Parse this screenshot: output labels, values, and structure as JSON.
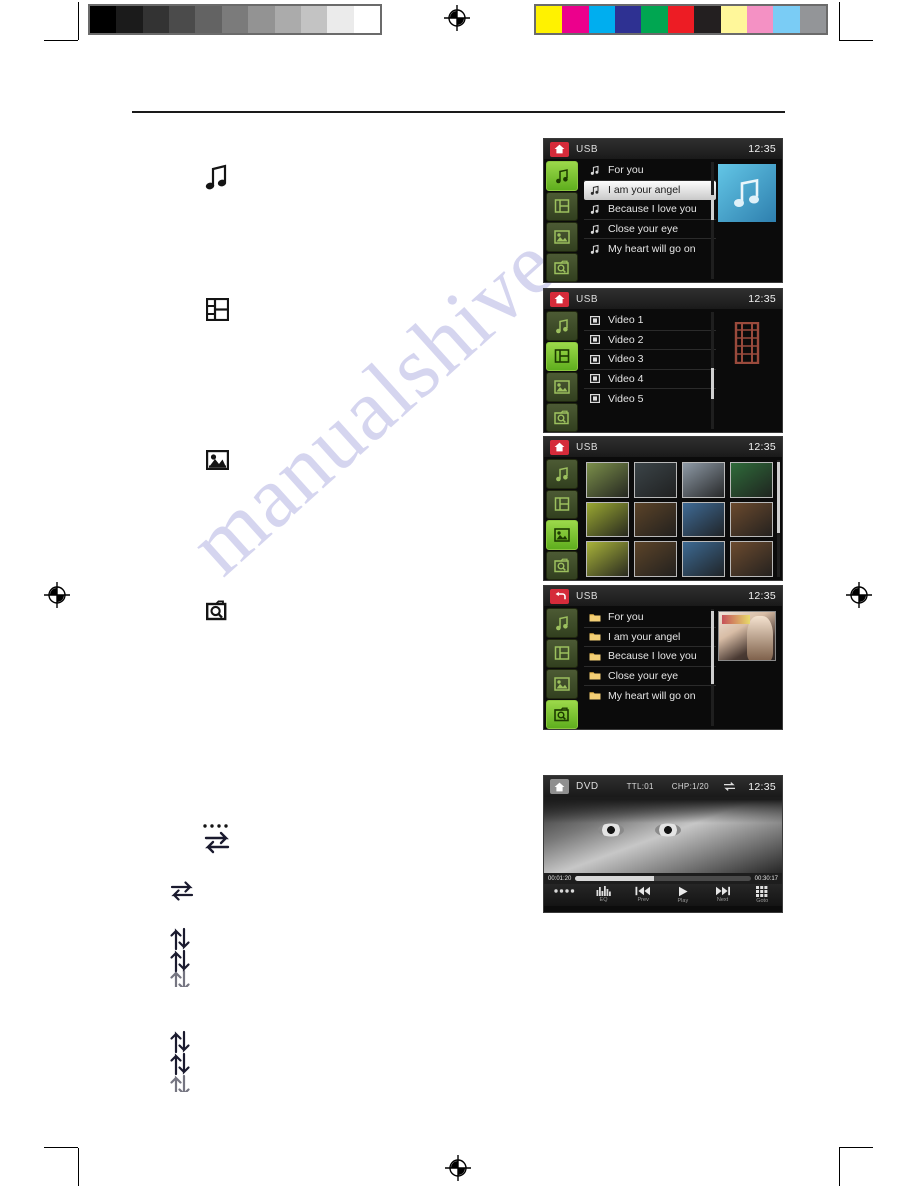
{
  "page": {
    "watermark": "manualshive",
    "calibration": {
      "gray_swatches": [
        "#000000",
        "#1b1b1b",
        "#333333",
        "#4b4b4b",
        "#636363",
        "#7b7b7b",
        "#939393",
        "#ababab",
        "#c3c3c3",
        "#ebebeb",
        "#ffffff"
      ],
      "color_swatches": [
        "#fff200",
        "#ec008c",
        "#00aeef",
        "#2e3192",
        "#00a651",
        "#ed1c24",
        "#231f20",
        "#fff79a",
        "#f491c4",
        "#7accf5",
        "#939598"
      ]
    }
  },
  "legend_icons": [
    {
      "name": "music-note-icon",
      "label": "Music"
    },
    {
      "name": "film-strip-icon",
      "label": "Video"
    },
    {
      "name": "picture-icon",
      "label": "Photo"
    },
    {
      "name": "folder-search-icon",
      "label": "Browse"
    },
    {
      "name": "repeat-dots-icon",
      "label": "Repeat"
    },
    {
      "name": "repeat-one-icon",
      "label": "Repeat one"
    },
    {
      "name": "repeat-all-icon",
      "label": "Repeat all"
    },
    {
      "name": "repeat-folder-icon",
      "label": "Repeat folder"
    }
  ],
  "screens": [
    {
      "id": "usb-music",
      "source": "USB",
      "clock": "12:35",
      "home_icon": "home-icon",
      "rail": [
        {
          "icon": "music-note-icon",
          "active": true
        },
        {
          "icon": "film-strip-icon",
          "active": false
        },
        {
          "icon": "picture-icon",
          "active": false
        },
        {
          "icon": "folder-search-icon",
          "active": false
        }
      ],
      "rows": [
        {
          "icon": "music-note-icon",
          "label": "For you",
          "selected": false
        },
        {
          "icon": "music-note-icon",
          "label": "I am your angel",
          "selected": true
        },
        {
          "icon": "music-note-icon",
          "label": "Because I love you",
          "selected": false
        },
        {
          "icon": "music-note-icon",
          "label": "Close your eye",
          "selected": false
        },
        {
          "icon": "music-note-icon",
          "label": "My heart will go on",
          "selected": false
        }
      ],
      "art": "album-art-music-note"
    },
    {
      "id": "usb-video",
      "source": "USB",
      "clock": "12:35",
      "home_icon": "home-icon",
      "rail": [
        {
          "icon": "music-note-icon",
          "active": false
        },
        {
          "icon": "film-strip-icon",
          "active": true
        },
        {
          "icon": "picture-icon",
          "active": false
        },
        {
          "icon": "folder-search-icon",
          "active": false
        }
      ],
      "rows": [
        {
          "icon": "video-clip-icon",
          "label": "Video 1",
          "selected": false
        },
        {
          "icon": "video-clip-icon",
          "label": "Video 2",
          "selected": false
        },
        {
          "icon": "video-clip-icon",
          "label": "Video 3",
          "selected": false
        },
        {
          "icon": "video-clip-icon",
          "label": "Video 4",
          "selected": false
        },
        {
          "icon": "video-clip-icon",
          "label": "Video 5",
          "selected": false
        }
      ],
      "art": "film-strip-art"
    },
    {
      "id": "usb-photo",
      "source": "USB",
      "clock": "12:35",
      "home_icon": "home-icon",
      "rail": [
        {
          "icon": "music-note-icon",
          "active": false
        },
        {
          "icon": "film-strip-icon",
          "active": false
        },
        {
          "icon": "picture-icon",
          "active": true
        },
        {
          "icon": "folder-search-icon",
          "active": false
        }
      ],
      "thumbnails": [
        "#7b8f4a",
        "#3b4448",
        "#8e9aa6",
        "#2f6b3a",
        "#9aa832",
        "#5b4328",
        "#3f6b96",
        "#6b4a2e",
        "#a8b33a",
        "#5c4429",
        "#3d6a93",
        "#6c4b2f"
      ]
    },
    {
      "id": "usb-browse",
      "source": "USB",
      "clock": "12:35",
      "home_icon": "back-icon",
      "rail": [
        {
          "icon": "music-note-icon",
          "active": false
        },
        {
          "icon": "film-strip-icon",
          "active": false
        },
        {
          "icon": "picture-icon",
          "active": false
        },
        {
          "icon": "folder-search-icon",
          "active": true
        }
      ],
      "rows": [
        {
          "icon": "folder-icon",
          "label": "For you",
          "selected": false
        },
        {
          "icon": "folder-icon",
          "label": "I am your angel",
          "selected": false
        },
        {
          "icon": "folder-icon",
          "label": "Because I love you",
          "selected": false
        },
        {
          "icon": "folder-icon",
          "label": "Close your eye",
          "selected": false
        },
        {
          "icon": "folder-icon",
          "label": "My heart will go on",
          "selected": false
        }
      ],
      "art": "album-cover-photo"
    }
  ],
  "dvd": {
    "source": "DVD",
    "title_label": "TTL:01",
    "chapter_label": "CHP:1/20",
    "repeat_icon": "repeat-icon",
    "clock": "12:35",
    "elapsed": "00:01:20",
    "total": "00:30:17",
    "progress_percent": 45,
    "home_icon": "home-icon",
    "controls": [
      {
        "icon": "dots-icon",
        "label": ""
      },
      {
        "icon": "eq-icon",
        "label": "EQ"
      },
      {
        "icon": "prev-icon",
        "label": "Prev"
      },
      {
        "icon": "play-icon",
        "label": "Play"
      },
      {
        "icon": "next-icon",
        "label": "Next"
      },
      {
        "icon": "goto-grid-icon",
        "label": "Goto"
      }
    ]
  }
}
